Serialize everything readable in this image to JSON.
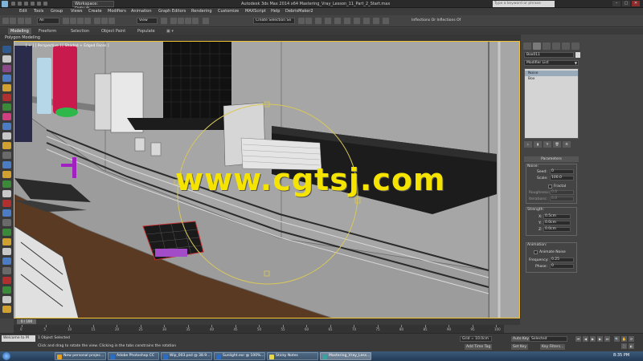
{
  "titlebar": {
    "workspace": "Workspace: Default",
    "title": "Autodesk 3ds Max 2014 x64     Mastering_Vray_Lesson_11_Part_2_Start.max",
    "search_placeholder": "Type a keyword or phrase",
    "window_controls": [
      "–",
      "▢",
      "✕"
    ]
  },
  "menubar": {
    "items": [
      "Edit",
      "Tools",
      "Group",
      "Views",
      "Create",
      "Modifiers",
      "Animation",
      "Graph Editors",
      "Rendering",
      "Customize",
      "MAXScript",
      "Help",
      "DebrisMaker2"
    ]
  },
  "toolbar": {
    "filter": "All",
    "ref_coord": "View",
    "selection_set": "Create Selection Se",
    "inflections": "Inflections Or Inflections Of"
  },
  "ribbon": {
    "tabs": [
      "Modeling",
      "Freeform",
      "Selection",
      "Object Paint",
      "Populate"
    ],
    "active_tab": "Modeling",
    "subtitle": "Polygon Modeling"
  },
  "viewport": {
    "label": "[ + ] [ Perspective ] [ Shaded + Edged Faces ]",
    "watermark": "www.cgtsj.com",
    "colors": {
      "background": "#8e8e8e",
      "wall": "#a6a6a6",
      "counter": "#5a3a22",
      "shelf": "#1c1c1c",
      "gizmo": "#d9c85a",
      "watermark": "#f5e300"
    }
  },
  "command_panel": {
    "object_name": "Box011",
    "modifier_list": "Modifier List",
    "stack": [
      "Noise",
      "Box"
    ],
    "stack_selected": "Noise",
    "parameters_title": "Parameters",
    "noise_label": "Noise:",
    "seed_label": "Seed:",
    "seed_value": "0",
    "scale_label": "Scale:",
    "scale_value": "100.0",
    "fractal_label": "Fractal",
    "roughness_label": "Roughness:",
    "roughness_value": "0.0",
    "iterations_label": "Iterations:",
    "iterations_value": "6.0",
    "strength_label": "Strength:",
    "x_label": "X:",
    "x_value": "0.5cm",
    "y_label": "Y:",
    "y_value": "0.0cm",
    "z_label": "Z:",
    "z_value": "0.0cm",
    "animation_label": "Animation:",
    "animate_noise_label": "Animate Noise",
    "frequency_label": "Frequency:",
    "frequency_value": "0.25",
    "phase_label": "Phase:",
    "phase_value": "0"
  },
  "timeline": {
    "slider": "0 / 100",
    "ticks": [
      "0",
      "5",
      "10",
      "15",
      "20",
      "25",
      "30",
      "35",
      "40",
      "45",
      "50",
      "55",
      "60",
      "65",
      "70",
      "75",
      "80",
      "85",
      "90",
      "95",
      "100"
    ]
  },
  "statusbar": {
    "welcome": "Welcome to M",
    "objects_selected": "1 Object Selected",
    "prompt": "Click and drag to rotate the view.  Clicking in the tabs constrains the rotation",
    "grid": "Grid = 10.0cm",
    "add_time_tag": "Add Time Tag",
    "auto_key": "Auto Key",
    "set_key": "Set Key",
    "selected": "Selected",
    "key_filters": "Key Filters..."
  },
  "taskbar": {
    "items": [
      {
        "label": "New personal projec...",
        "color": "#e8a020"
      },
      {
        "label": "Adobe Photoshop CC",
        "color": "#2b6cc4"
      },
      {
        "label": "Wip_003.psd @ 38.9...",
        "color": "#2b6cc4"
      },
      {
        "label": "Sunlight.exr @ 100%...",
        "color": "#2b6cc4"
      },
      {
        "label": "Sticky Notes",
        "color": "#e6d84a"
      },
      {
        "label": "Mastering_Vray_Less...",
        "color": "#3aa0a0"
      }
    ],
    "time": "8:35 PM"
  }
}
